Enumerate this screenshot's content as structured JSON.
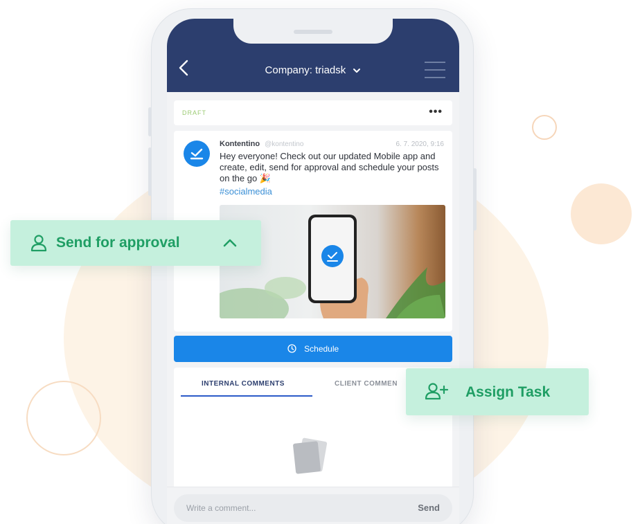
{
  "header": {
    "company_label": "Company: triadsk"
  },
  "post": {
    "status": "DRAFT",
    "more_label": "•••",
    "author_name": "Kontentino",
    "author_handle": "@kontentino",
    "date": "6. 7. 2020, 9:16",
    "text": "Hey everyone! Check out our updated Mobile app and create, edit, send for approval and schedule your posts on the go 🎉",
    "hashtag": "#socialmedia"
  },
  "actions": {
    "schedule_label": "Schedule",
    "send_for_approval_label": "Send for approval",
    "assign_task_label": "Assign Task"
  },
  "comments": {
    "tabs": [
      {
        "label": "INTERNAL COMMENTS",
        "active": true
      },
      {
        "label": "CLIENT COMMEN",
        "active": false
      }
    ],
    "input_placeholder": "Write a comment...",
    "send_label": "Send"
  },
  "colors": {
    "header_bg": "#2c3e6e",
    "accent_blue": "#1a86e8",
    "pill_green_bg": "#c5f0dd",
    "pill_green_text": "#1f9e64",
    "draft_green": "#9ccb74"
  },
  "icons": {
    "back": "chevron-left-icon",
    "menu": "hamburger-menu-icon",
    "avatar": "kontentino-logo-icon",
    "schedule": "clock-icon",
    "approval": "user-icon",
    "approval_toggle": "chevron-up-icon",
    "assign": "user-plus-icon",
    "empty": "document-stack-icon"
  }
}
